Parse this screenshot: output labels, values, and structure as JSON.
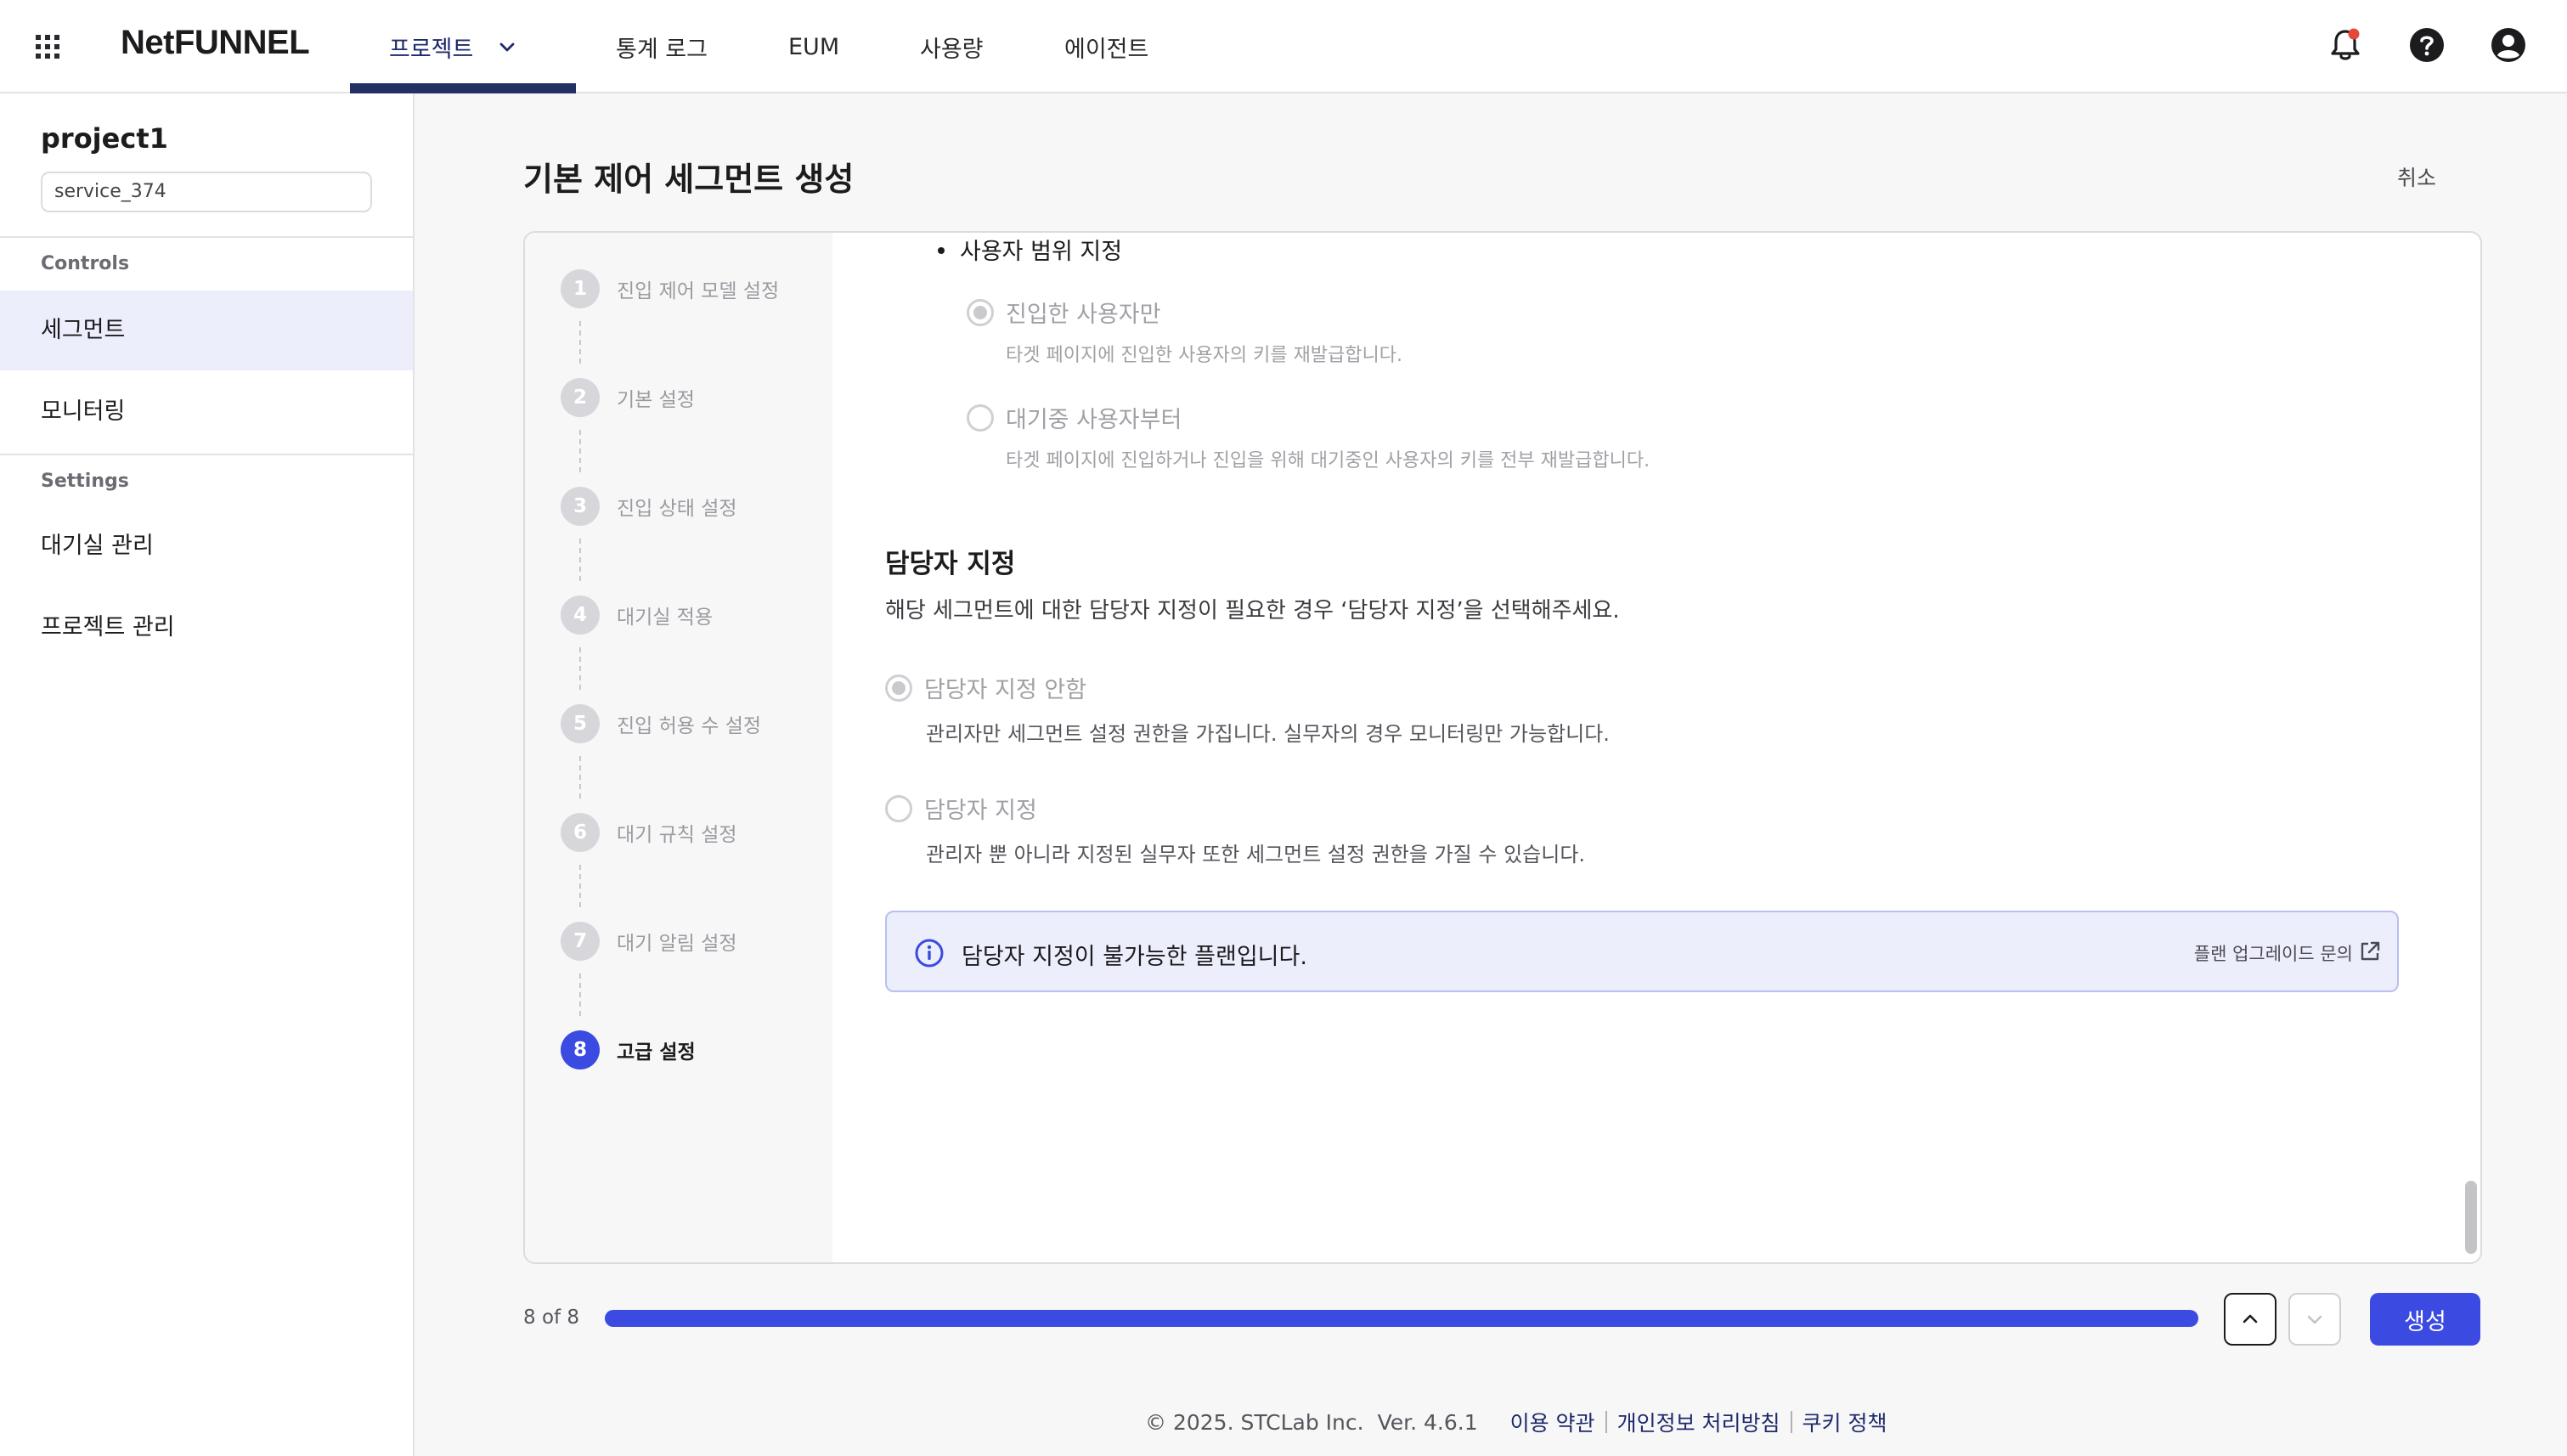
{
  "app": {
    "logo": "NetFUNNEL",
    "nav": [
      {
        "label": "프로젝트",
        "active": true
      },
      {
        "label": "통계 로그"
      },
      {
        "label": "EUM"
      },
      {
        "label": "사용량"
      },
      {
        "label": "에이전트"
      }
    ],
    "notification_badge_color": "#e5483b",
    "accent_color": "#3b4ae0"
  },
  "sidebar": {
    "project_name": "project1",
    "service_select": "service_374",
    "sections": [
      {
        "title": "Controls",
        "items": [
          {
            "label": "세그먼트",
            "active": true
          },
          {
            "label": "모니터링"
          }
        ]
      },
      {
        "title": "Settings",
        "items": [
          {
            "label": "대기실 관리"
          },
          {
            "label": "프로젝트 관리"
          }
        ]
      }
    ]
  },
  "page": {
    "title": "기본 제어 세그먼트 생성",
    "cancel_label": "취소"
  },
  "steps": [
    {
      "num": "1",
      "label": "진입 제어 모델 설정"
    },
    {
      "num": "2",
      "label": "기본 설정"
    },
    {
      "num": "3",
      "label": "진입 상태 설정"
    },
    {
      "num": "4",
      "label": "대기실 적용"
    },
    {
      "num": "5",
      "label": "진입 허용 수 설정"
    },
    {
      "num": "6",
      "label": "대기 규칙 설정"
    },
    {
      "num": "7",
      "label": "대기 알림 설정"
    },
    {
      "num": "8",
      "label": "고급 설정",
      "active": true
    }
  ],
  "user_scope": {
    "title": "사용자 범위 지정",
    "options": [
      {
        "label": "진입한 사용자만",
        "desc": "타겟 페이지에 진입한 사용자의 키를 재발급합니다.",
        "checked": true
      },
      {
        "label": "대기중 사용자부터",
        "desc": "타겟 페이지에 진입하거나 진입을 위해 대기중인 사용자의 키를 전부 재발급합니다.",
        "checked": false
      }
    ]
  },
  "assignee": {
    "title": "담당자 지정",
    "desc": "해당 세그먼트에 대한 담당자 지정이 필요한 경우 ‘담당자 지정’을 선택해주세요.",
    "options": [
      {
        "label": "담당자 지정 안함",
        "desc": "관리자만 세그먼트 설정 권한을 가집니다. 실무자의 경우 모니터링만 가능합니다.",
        "checked": true
      },
      {
        "label": "담당자 지정",
        "desc": "관리자 뿐 아니라 지정된 실무자 또한 세그먼트 설정 권한을 가질 수 있습니다.",
        "checked": false
      }
    ],
    "info_text": "담당자 지정이 불가능한 플랜입니다.",
    "info_link": "플랜 업그레이드 문의"
  },
  "progress": {
    "label": "8 of 8",
    "fraction": 1.0,
    "create_label": "생성"
  },
  "footer": {
    "copyright": "© 2025. STCLab Inc.",
    "version": "Ver. 4.6.1",
    "links": [
      "이용 약관",
      "개인정보 처리방침",
      "쿠키 정책"
    ]
  }
}
